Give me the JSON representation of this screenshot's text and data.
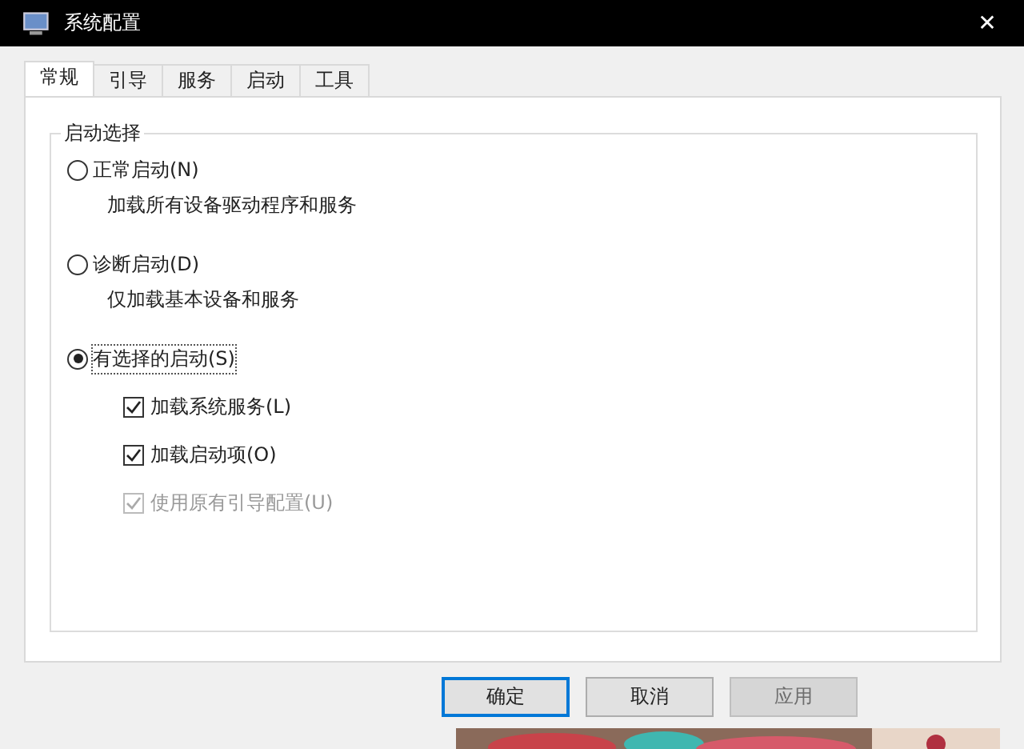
{
  "window": {
    "title": "系统配置",
    "close": "✕"
  },
  "tabs": [
    {
      "label": "常规",
      "selected": true
    },
    {
      "label": "引导",
      "selected": false
    },
    {
      "label": "服务",
      "selected": false
    },
    {
      "label": "启动",
      "selected": false
    },
    {
      "label": "工具",
      "selected": false
    }
  ],
  "group": {
    "title": "启动选择",
    "options": [
      {
        "label": "正常启动(N)",
        "description": "加载所有设备驱动程序和服务",
        "selected": false
      },
      {
        "label": "诊断启动(D)",
        "description": "仅加载基本设备和服务",
        "selected": false
      },
      {
        "label": "有选择的启动(S)",
        "selected": true,
        "checkboxes": [
          {
            "label": "加载系统服务(L)",
            "checked": true,
            "disabled": false
          },
          {
            "label": "加载启动项(O)",
            "checked": true,
            "disabled": false
          },
          {
            "label": "使用原有引导配置(U)",
            "checked": true,
            "disabled": true
          }
        ]
      }
    ]
  },
  "buttons": [
    {
      "label": "确定",
      "disabled": false,
      "default": true
    },
    {
      "label": "取消",
      "disabled": false,
      "default": false
    },
    {
      "label": "应用",
      "disabled": true,
      "default": false
    }
  ]
}
